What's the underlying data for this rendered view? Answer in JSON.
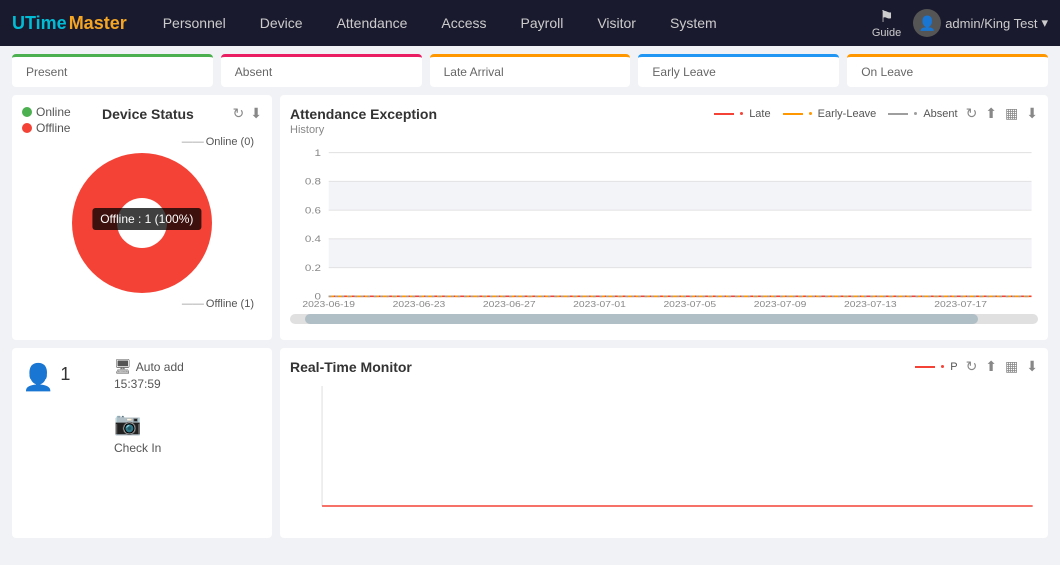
{
  "navbar": {
    "logo": {
      "u": "U",
      "time": "Time",
      "master": "Master"
    },
    "items": [
      {
        "label": "Personnel",
        "id": "personnel"
      },
      {
        "label": "Device",
        "id": "device"
      },
      {
        "label": "Attendance",
        "id": "attendance"
      },
      {
        "label": "Access",
        "id": "access"
      },
      {
        "label": "Payroll",
        "id": "payroll"
      },
      {
        "label": "Visitor",
        "id": "visitor"
      },
      {
        "label": "System",
        "id": "system"
      }
    ],
    "guide_label": "Guide",
    "user": "admin/King Test"
  },
  "summary": {
    "cards": [
      {
        "label": "Present",
        "class": "present"
      },
      {
        "label": "Absent",
        "class": "absent"
      },
      {
        "label": "Late Arrival",
        "class": "late"
      },
      {
        "label": "Early Leave",
        "class": "early"
      },
      {
        "label": "On Leave",
        "class": "on-leave"
      }
    ]
  },
  "device_status": {
    "title": "Device Status",
    "legend": [
      {
        "label": "Online",
        "color": "#4caf50"
      },
      {
        "label": "Offline",
        "color": "#f44336"
      }
    ],
    "online_label": "Online (0)",
    "offline_label": "Offline (1)",
    "tooltip": "Offline : 1 (100%)"
  },
  "attendance_exception": {
    "title": "Attendance Exception",
    "history_label": "History",
    "legend": [
      {
        "label": "Late",
        "color": "#f44336"
      },
      {
        "label": "Early-Leave",
        "color": "#ff9800"
      },
      {
        "label": "Absent",
        "color": "#9e9e9e"
      }
    ],
    "y_axis": [
      "1",
      "0.8",
      "0.6",
      "0.4",
      "0.2",
      "0"
    ],
    "x_axis": [
      "2023-06-19",
      "2023-06-23",
      "2023-06-27",
      "2023-07-01",
      "2023-07-05",
      "2023-07-09",
      "2023-07-13",
      "2023-07-17"
    ]
  },
  "checkin": {
    "count": "1",
    "auto_add_label": "Auto add",
    "time": "15:37:59",
    "type_label": "Check In"
  },
  "realtime_monitor": {
    "title": "Real-Time Monitor",
    "legend_label": "P"
  }
}
